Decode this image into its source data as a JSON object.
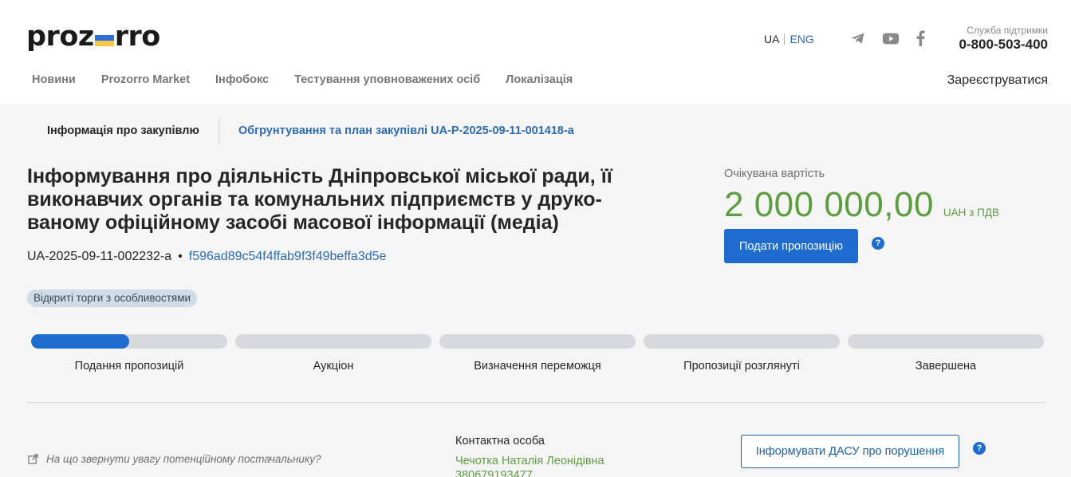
{
  "header": {
    "logo_left": "proz",
    "logo_right": "rro",
    "lang": {
      "ua": "UA",
      "eng": "ENG"
    },
    "socials": [
      "telegram-icon",
      "youtube-icon",
      "facebook-icon"
    ],
    "support_label": "Служба підтримки",
    "support_phone": "0-800-503-400",
    "nav": [
      "Новини",
      "Prozorro Market",
      "Інфобокс",
      "Тестування уповноважених осіб",
      "Локалізація"
    ],
    "register": "Зареєструватися"
  },
  "subtabs": {
    "info": "Інформація про закупівлю",
    "plan": "Обгрунтування та план закупівлі UA-P-2025-09-11-001418-a"
  },
  "tender": {
    "title": "Інформування про діяльність Дніпровської міської ради, її виконавчих органів та комунальних підприємств у друко-ваному офіційному засобі масової інформації (медіа)",
    "id": "UA-2025-09-11-002232-a",
    "dot": "•",
    "hash": "f596ad89c54f4ffab9f3f49beffa3d5e",
    "type_badge": "Відкриті торги з особливостями"
  },
  "value": {
    "label": "Очікувана вартість",
    "amount": "2 000 000,00",
    "currency": "UAH з ПДВ",
    "submit_button": "Подати пропозицію",
    "help": "?"
  },
  "stages": [
    {
      "label": "Подання пропозицій",
      "progress": 0.5
    },
    {
      "label": "Аукціон",
      "progress": 0
    },
    {
      "label": "Визначення переможця",
      "progress": 0
    },
    {
      "label": "Пропозиції розглянуті",
      "progress": 0
    },
    {
      "label": "Завершена",
      "progress": 0
    }
  ],
  "bottom": {
    "hint": "На що звернути увагу потенційному постачальнику?",
    "contact_label": "Контактна особа",
    "contact_name": "Чечотка Наталія Леонідівна",
    "contact_phone": "380679193477",
    "dasu_button": "Інформувати ДАСУ про порушення",
    "help": "?"
  },
  "colors": {
    "accent": "#1f6cd0",
    "link": "#2d6bb3",
    "money": "#5c9e3f",
    "bar_bg": "#d7d9dd"
  }
}
